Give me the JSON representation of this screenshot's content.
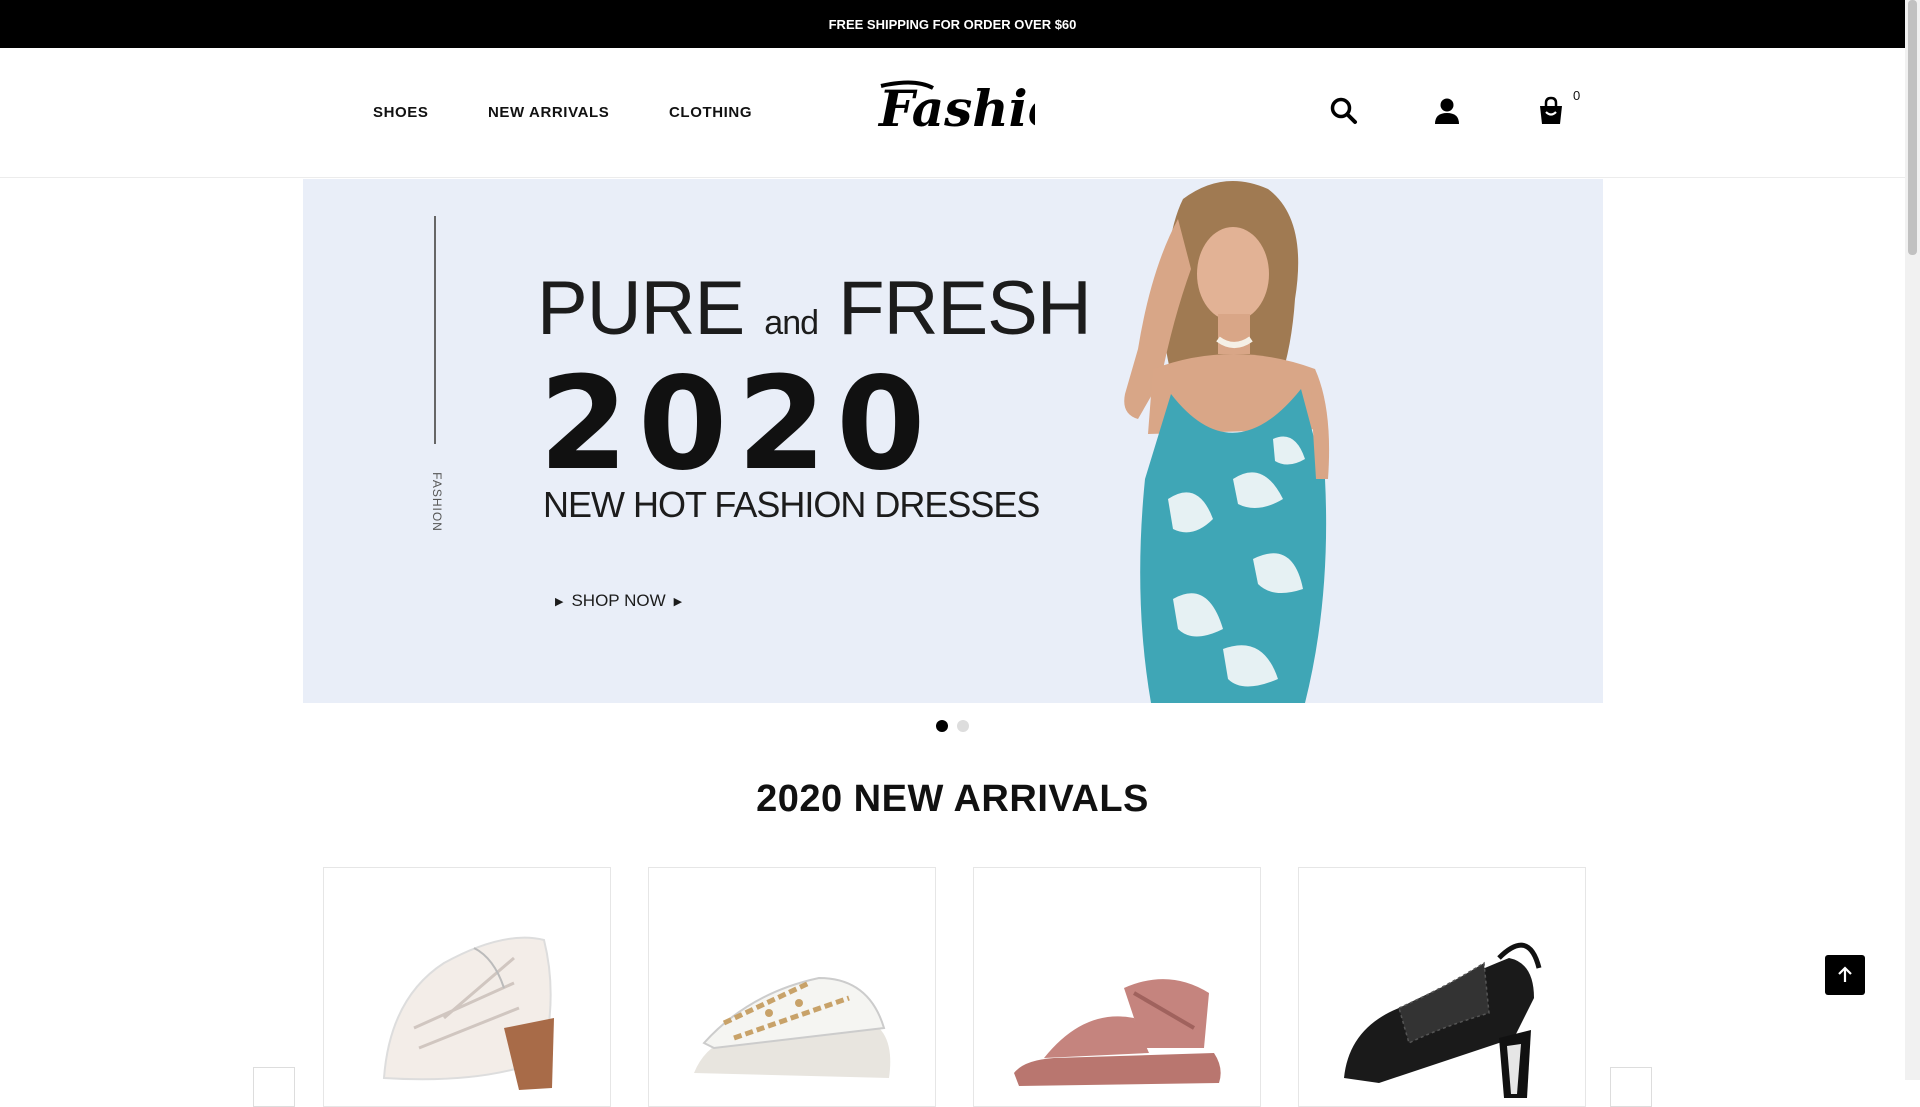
{
  "announcement": "FREE SHIPPING FOR ORDER OVER $60",
  "nav": {
    "shoes": "SHOES",
    "new_arrivals": "NEW ARRIVALS",
    "clothing": "CLOTHING"
  },
  "logo_text": "Fashion",
  "header_icons": {
    "search": "search-icon",
    "account": "user-icon",
    "cart": "shopping-bag-icon"
  },
  "cart_count": "0",
  "banner": {
    "side_text": "FASHION",
    "line1_a": "PURE",
    "line1_b": "and",
    "line1_c": "FRESH",
    "year": "2020",
    "subtitle": "NEW HOT FASHION DRESSES",
    "cta": "SHOP NOW"
  },
  "slider": {
    "slides": 2,
    "active": 1
  },
  "section_title": "2020 NEW ARRIVALS",
  "products": [
    {
      "icon": "white-heeled-sandal"
    },
    {
      "icon": "chunky-chain-sandal"
    },
    {
      "icon": "pink-strap-sandal"
    },
    {
      "icon": "black-mesh-heel"
    }
  ],
  "colors": {
    "topbar": "#000000",
    "banner_bg": "#e9eef8",
    "dress": "#3fa6b6",
    "accent": "#111111"
  }
}
